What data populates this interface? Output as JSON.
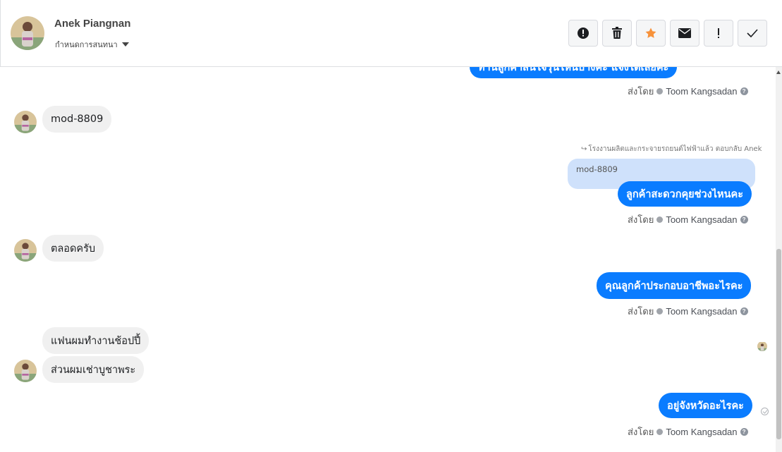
{
  "header": {
    "contact_name": "Anek Piangnan",
    "label_selector": "กำหนดการสนทนา",
    "avatar_icon": "contact-photo",
    "toolbar": [
      {
        "name": "spam-button",
        "icon": "exclamation-circle-icon"
      },
      {
        "name": "delete-button",
        "icon": "trash-icon"
      },
      {
        "name": "star-button",
        "icon": "star-icon",
        "color": "#f7923b"
      },
      {
        "name": "mark-unread-button",
        "icon": "envelope-icon"
      },
      {
        "name": "important-button",
        "icon": "exclamation-icon"
      },
      {
        "name": "done-button",
        "icon": "check-icon"
      }
    ]
  },
  "sent_by_prefix": "ส่งโดย",
  "agent_name": "Toom Kangsadan",
  "messages": {
    "m0_partial": "ท่านลูกค้าสนใจรุ่นไหนบ้างคะ แจ้งได้เลยค่ะ",
    "m1": "mod-8809",
    "reply_note": "โรงงานผลิตและกระจายรถยนต์ไฟฟ้าแล้ว ตอบกลับ Anek",
    "quoted": "mod-8809",
    "m2": "ลูกค้าสะดวกคุยช่วงไหนคะ",
    "m3": "ตลอดครับ",
    "m4": "คุณลูกค้าประกอบอาชีพอะไรคะ",
    "m5": "แฟนผมทำงานช้อปปี้",
    "m6": "ส่วนผมเช่าบูชาพระ",
    "m7": "อยู่จังหวัดอะไรคะ"
  },
  "colors": {
    "outgoing_bubble": "#0a7cff",
    "incoming_bubble": "#f0f0f0",
    "quote_bg": "#cfe1fb"
  }
}
